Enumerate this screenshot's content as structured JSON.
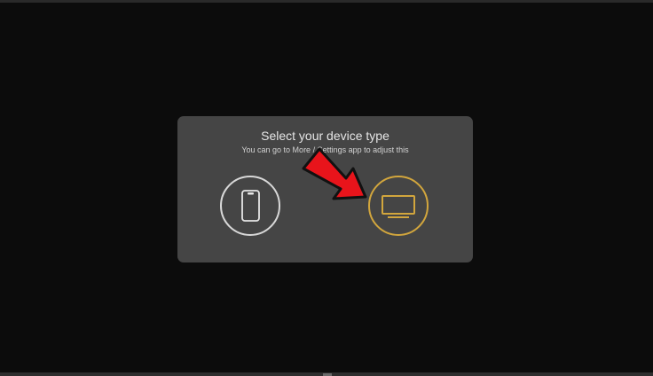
{
  "dialog": {
    "title": "Select your device type",
    "subtitle": "You can go to More / Settings app to adjust this"
  },
  "options": [
    {
      "name": "phone",
      "icon": "phone-icon",
      "selected": false
    },
    {
      "name": "tv",
      "icon": "tv-icon",
      "selected": true
    }
  ],
  "colors": {
    "background": "#0c0c0c",
    "dialog": "#454545",
    "selected_accent": "#d2a63d",
    "unselected_ring": "#d8d8d8",
    "annotation_arrow": "#e8141b"
  }
}
